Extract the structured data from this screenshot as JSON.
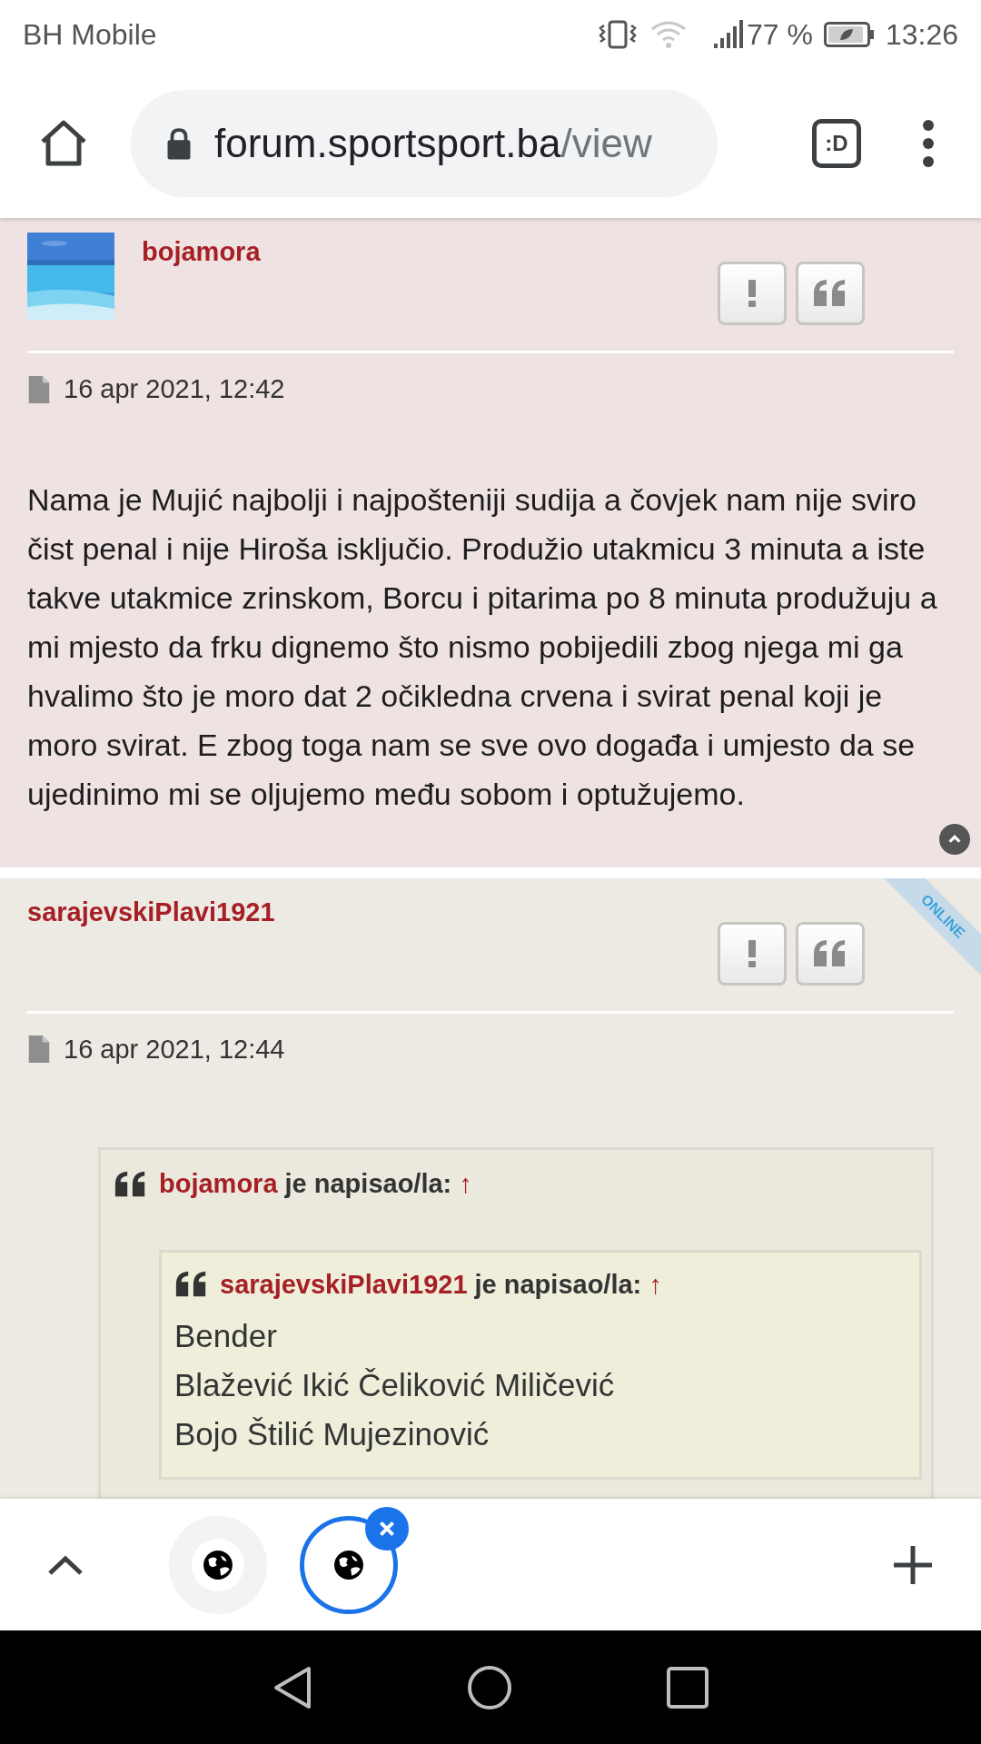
{
  "status_bar": {
    "carrier": "BH Mobile",
    "battery": "77 %",
    "time": "13:26"
  },
  "browser": {
    "url_host": "forum.sportsport.ba",
    "url_path": "/view",
    "tab_count": ":D"
  },
  "posts": [
    {
      "author": "bojamora",
      "has_avatar": true,
      "online": false,
      "date": "16 apr 2021, 12:42",
      "body": [
        "Nama je Mujić najbolji i najpošteniji sudija a čovjek nam nije sviro čist penal i nije Hiroša isključio. Produžio utakmicu 3 minuta a iste takve utakmice zrinskom, Borcu i pitarima po 8 minuta produžuju a mi mjesto da frku dignemo što nismo pobijedili zbog njega mi ga hvalimo što je moro dat 2 očikledna crvena i svirat penal koji je moro svirat. E zbog toga nam se sve ovo događa i umjesto da se ujedinimo mi se oljujemo među sobom i optužujemo."
      ],
      "back_to_top": true
    },
    {
      "author": "sarajevskiPlavi1921",
      "has_avatar": false,
      "online": true,
      "online_label": "ONLINE",
      "date": "16 apr 2021, 12:44",
      "quote": {
        "author": "bojamora",
        "wrote": "je napisao/la:",
        "arrow": "↑",
        "quote": {
          "author": "sarajevskiPlavi1921",
          "wrote": "je napisao/la:",
          "arrow": "↑",
          "lines": [
            "Bender",
            "Blažević Ikić Čeliković Miličević",
            "Bojo Štilić Mujezinović"
          ]
        }
      },
      "back_to_top": false
    }
  ],
  "tabs": [
    {
      "selected": false
    },
    {
      "selected": true
    }
  ]
}
